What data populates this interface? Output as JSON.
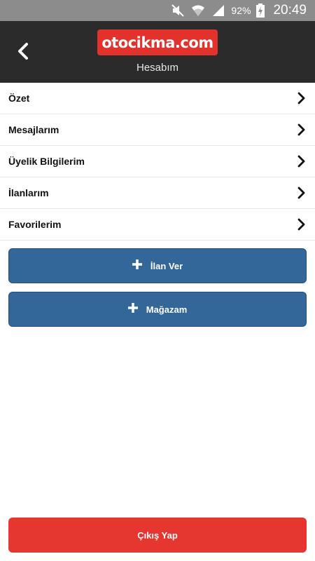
{
  "status_bar": {
    "battery_percent": "92%",
    "time": "20:49",
    "icons": [
      "mute-icon",
      "wifi-icon",
      "signal-icon",
      "battery-charging-icon"
    ]
  },
  "header": {
    "logo_text": "otocikma.com",
    "subtitle": "Hesabım",
    "brand_color": "#e3312c",
    "background_color": "#2b2b2b"
  },
  "menu": {
    "items": [
      {
        "label": "Özet"
      },
      {
        "label": "Mesajlarım"
      },
      {
        "label": "Üyelik Bilgilerim"
      },
      {
        "label": "İlanlarım"
      },
      {
        "label": "Favorilerim"
      }
    ]
  },
  "actions": {
    "post_ad_label": "İlan Ver",
    "store_label": "Mağazam",
    "button_color": "#336699"
  },
  "logout": {
    "label": "Çıkış Yap",
    "color": "#e5362f"
  }
}
